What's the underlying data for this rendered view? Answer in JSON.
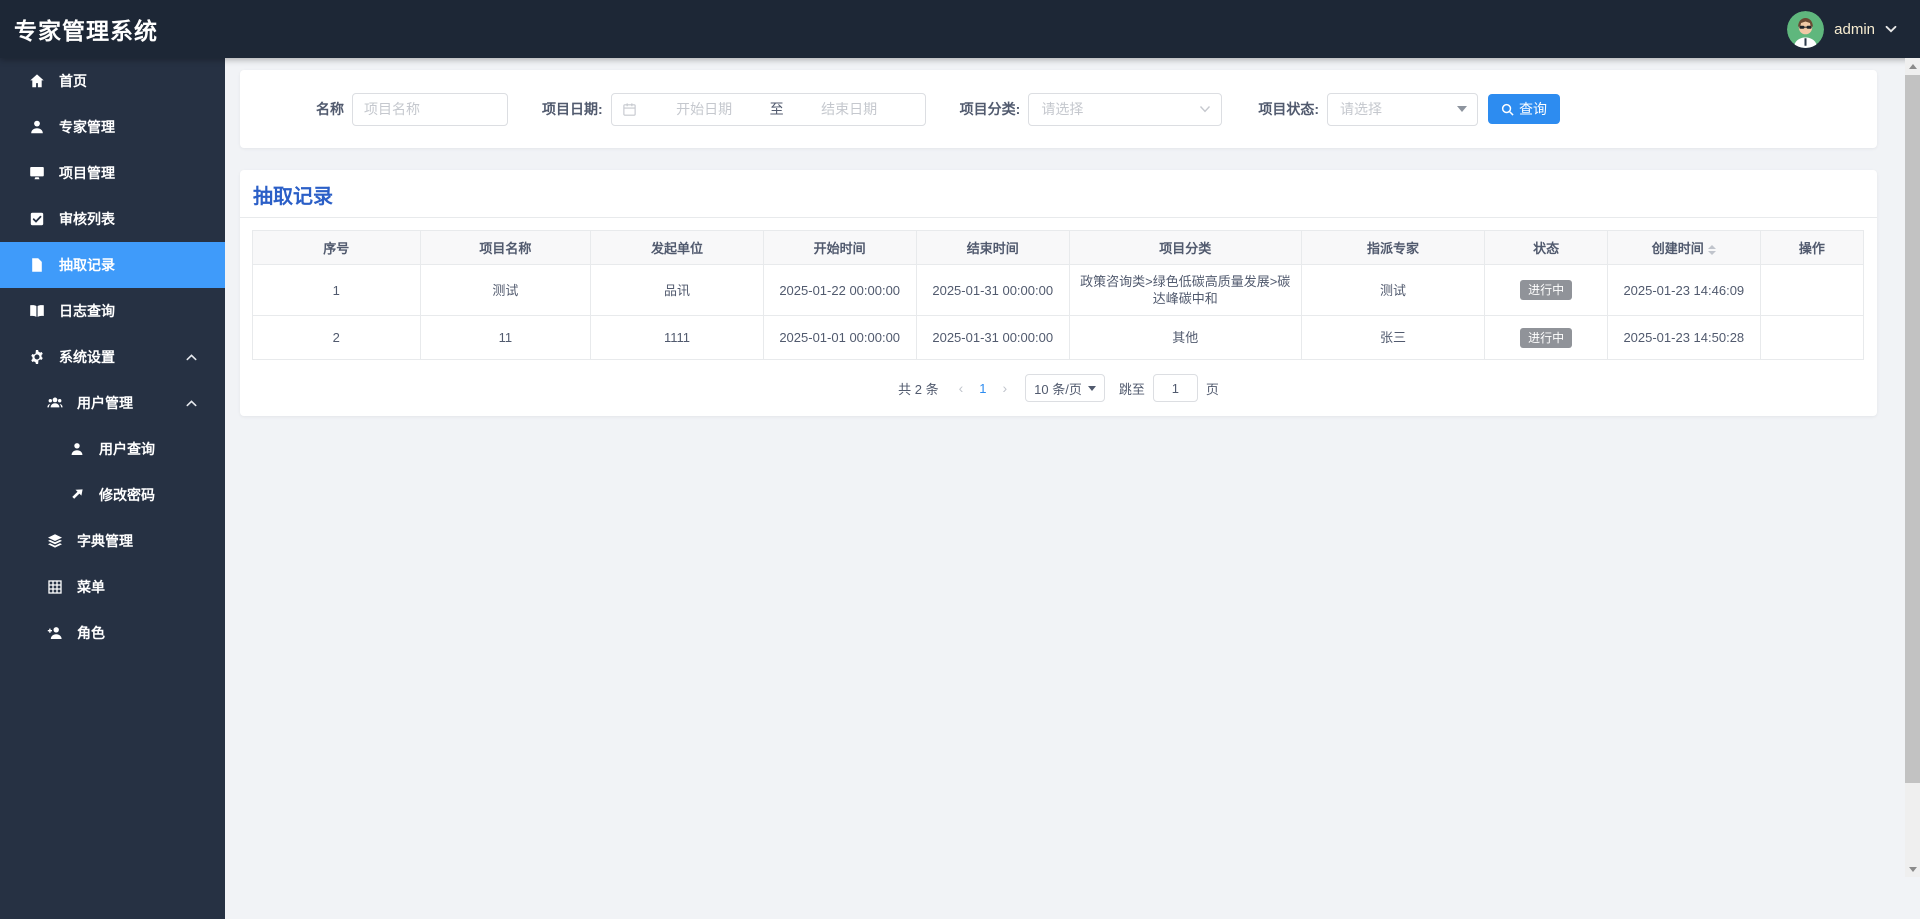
{
  "app": {
    "title": "专家管理系统"
  },
  "header": {
    "user": "admin"
  },
  "sidebar": {
    "items": [
      {
        "label": "首页",
        "icon": "home-icon",
        "level": 1
      },
      {
        "label": "专家管理",
        "icon": "expert-icon",
        "level": 1
      },
      {
        "label": "项目管理",
        "icon": "monitor-icon",
        "level": 1
      },
      {
        "label": "审核列表",
        "icon": "audit-check-icon",
        "level": 1
      },
      {
        "label": "抽取记录",
        "icon": "document-icon",
        "level": 1,
        "active": true
      },
      {
        "label": "日志查询",
        "icon": "log-book-icon",
        "level": 1
      },
      {
        "label": "系统设置",
        "icon": "gear-icon",
        "level": 1,
        "expanded": true
      },
      {
        "label": "用户管理",
        "icon": "users-icon",
        "level": 2,
        "expanded": true
      },
      {
        "label": "用户查询",
        "icon": "user-icon",
        "level": 3
      },
      {
        "label": "修改密码",
        "icon": "arrow-icon",
        "level": 3
      },
      {
        "label": "字典管理",
        "icon": "layers-icon",
        "level": 2
      },
      {
        "label": "菜单",
        "icon": "grid-icon",
        "level": 2
      },
      {
        "label": "角色",
        "icon": "role-add-icon",
        "level": 2
      }
    ]
  },
  "filters": {
    "name_label": "名称",
    "name_placeholder": "项目名称",
    "date_label": "项目日期:",
    "date_start_placeholder": "开始日期",
    "date_separator": "至",
    "date_end_placeholder": "结束日期",
    "category_label": "项目分类:",
    "category_placeholder": "请选择",
    "status_label": "项目状态:",
    "status_placeholder": "请选择",
    "search_button": "查询"
  },
  "page": {
    "title": "抽取记录"
  },
  "table": {
    "columns": [
      "序号",
      "项目名称",
      "发起单位",
      "开始时间",
      "结束时间",
      "项目分类",
      "指派专家",
      "状态",
      "创建时间",
      "操作"
    ],
    "rows": [
      {
        "no": "1",
        "name": "测试",
        "org": "品讯",
        "start": "2025-01-22 00:00:00",
        "end": "2025-01-31 00:00:00",
        "category": "政策咨询类>绿色低碳高质量发展>碳达峰碳中和",
        "expert": "测试",
        "status": "进行中",
        "created": "2025-01-23 14:46:09",
        "action": ""
      },
      {
        "no": "2",
        "name": "11",
        "org": "1111",
        "start": "2025-01-01 00:00:00",
        "end": "2025-01-31 00:00:00",
        "category": "其他",
        "expert": "张三",
        "status": "进行中",
        "created": "2025-01-23 14:50:28",
        "action": ""
      }
    ]
  },
  "pagination": {
    "total": "共 2 条",
    "prev": "‹",
    "current_page": "1",
    "next": "›",
    "page_size": "10 条/页",
    "jump_label": "跳至",
    "jump_value": "1",
    "jump_suffix": "页"
  },
  "colors": {
    "header_bg": "#1d2736",
    "sidebar_bg": "#263143",
    "sidebar_active": "#3f9bfa",
    "accent_blue": "#2d8cf0",
    "title_blue": "#2b5fc7",
    "status_badge": "#909399"
  }
}
